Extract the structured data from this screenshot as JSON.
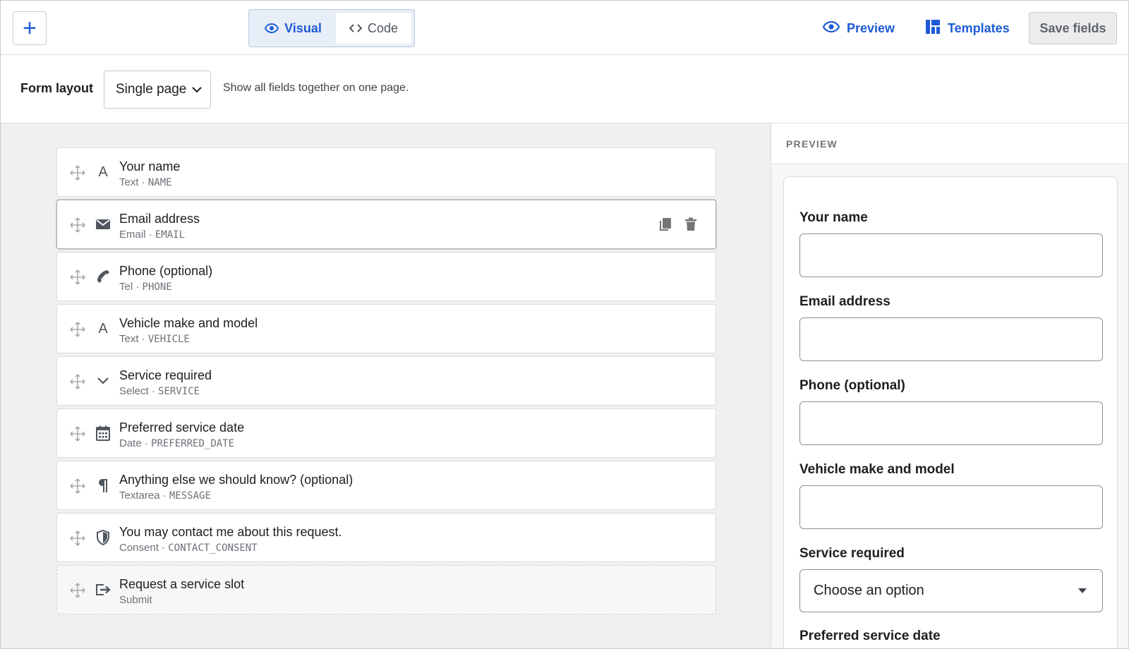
{
  "toolbar": {
    "add_label": "+",
    "mode_visual": "Visual",
    "mode_code": "Code",
    "preview_label": "Preview",
    "templates_label": "Templates",
    "save_label": "Save fields",
    "accent_color": "#1d5bd6"
  },
  "layout": {
    "label": "Form layout",
    "selected": "Single page",
    "hint": "Show all fields together on one page."
  },
  "fields": [
    {
      "title": "Your name",
      "type": "Text",
      "key": "NAME",
      "icon": "text-icon"
    },
    {
      "title": "Email address",
      "type": "Email",
      "key": "EMAIL",
      "icon": "envelope-icon"
    },
    {
      "title": "Phone (optional)",
      "type": "Tel",
      "key": "PHONE",
      "icon": "phone-icon"
    },
    {
      "title": "Vehicle make and model",
      "type": "Text",
      "key": "VEHICLE",
      "icon": "text-icon"
    },
    {
      "title": "Service required",
      "type": "Select",
      "key": "SERVICE",
      "icon": "chevron-down-icon"
    },
    {
      "title": "Preferred service date",
      "type": "Date",
      "key": "PREFERRED_DATE",
      "icon": "calendar-icon"
    },
    {
      "title": "Anything else we should know? (optional)",
      "type": "Textarea",
      "key": "MESSAGE",
      "icon": "paragraph-icon"
    },
    {
      "title": "You may contact me about this request.",
      "type": "Consent",
      "key": "CONTACT_CONSENT",
      "icon": "shield-icon"
    },
    {
      "title": "Request a service slot",
      "type": "Submit",
      "key": "",
      "icon": "submit-icon"
    }
  ],
  "separator": "·",
  "preview": {
    "heading": "PREVIEW",
    "labels": {
      "name": "Your name",
      "email": "Email address",
      "phone": "Phone (optional)",
      "vehicle": "Vehicle make and model",
      "service": "Service required",
      "date": "Preferred service date"
    },
    "service_placeholder": "Choose an option"
  }
}
